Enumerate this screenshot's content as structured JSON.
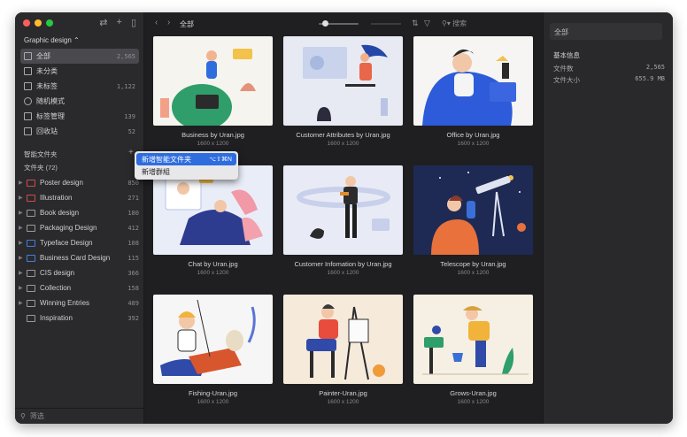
{
  "colors": {
    "accent": "#2f6ddf",
    "window_bg": "#232326",
    "sidebar_bg": "#2a2a2d"
  },
  "sidebar": {
    "library_title": "Graphic design ⌃",
    "nav": [
      {
        "icon": "all-icon",
        "label": "全部",
        "count": "2,565"
      },
      {
        "icon": "uncategorized-icon",
        "label": "未分类",
        "count": ""
      },
      {
        "icon": "untagged-icon",
        "label": "未标签",
        "count": "1,122"
      },
      {
        "icon": "random-icon",
        "label": "随机模式",
        "count": ""
      },
      {
        "icon": "tag-manage-icon",
        "label": "标签管理",
        "count": "139"
      },
      {
        "icon": "trash-icon",
        "label": "回收站",
        "count": "52"
      }
    ],
    "smart_folders_label": "智能文件夹",
    "folders_label": "文件夹 (72)",
    "folders": [
      {
        "label": "Poster design",
        "count": "850",
        "color": "#d24b4b"
      },
      {
        "label": "Illustration",
        "count": "271",
        "color": "#d24b4b"
      },
      {
        "label": "Book design",
        "count": "180",
        "color": "#9a9a9e"
      },
      {
        "label": "Packaging Design",
        "count": "412",
        "color": "#9a9a9e"
      },
      {
        "label": "Typeface Design",
        "count": "108",
        "color": "#3f7fe0"
      },
      {
        "label": "Business Card Design",
        "count": "115",
        "color": "#3f7fe0"
      },
      {
        "label": "CIS design",
        "count": "366",
        "color": "#9a9a9e"
      },
      {
        "label": "Collection",
        "count": "158",
        "color": "#9a9a9e"
      },
      {
        "label": "Winning Entries",
        "count": "489",
        "color": "#9a9a9e"
      },
      {
        "label": "Inspiration",
        "count": "392",
        "color": "#9a9a9e"
      }
    ],
    "filter_placeholder": "筛选"
  },
  "context_menu": {
    "items": [
      {
        "label": "新增智能文件夹",
        "shortcut": "⌥⇧⌘N",
        "highlighted": true
      },
      {
        "label": "新增群組",
        "shortcut": "",
        "highlighted": false
      }
    ]
  },
  "toolbar": {
    "breadcrumb": "全部",
    "search_placeholder": "搜索",
    "sort_icon": "sort-icon",
    "filter_icon": "filter-icon"
  },
  "items": [
    {
      "name": "Business by Uran.jpg",
      "dims": "1600 x 1200"
    },
    {
      "name": "Customer Attributes by Uran.jpg",
      "dims": "1600 x 1200"
    },
    {
      "name": "Office by Uran.jpg",
      "dims": "1600 x 1200"
    },
    {
      "name": "Chat by Uran.jpg",
      "dims": "1600 x 1200"
    },
    {
      "name": "Customer Infomation by Uran.jpg",
      "dims": "1600 x 1200"
    },
    {
      "name": "Telescope by Uran.jpg",
      "dims": "1600 x 1200"
    },
    {
      "name": "Fishing-Uran.jpg",
      "dims": "1600 x 1200"
    },
    {
      "name": "Painter-Uran.jpg",
      "dims": "1600 x 1200"
    },
    {
      "name": "Grows-Uran.jpg",
      "dims": "1600 x 1200"
    }
  ],
  "inspector": {
    "title_field": "全部",
    "heading": "基本信息",
    "rows": [
      {
        "label": "文件数",
        "value": "2,565"
      },
      {
        "label": "文件大小",
        "value": "655.9 MB"
      }
    ]
  }
}
